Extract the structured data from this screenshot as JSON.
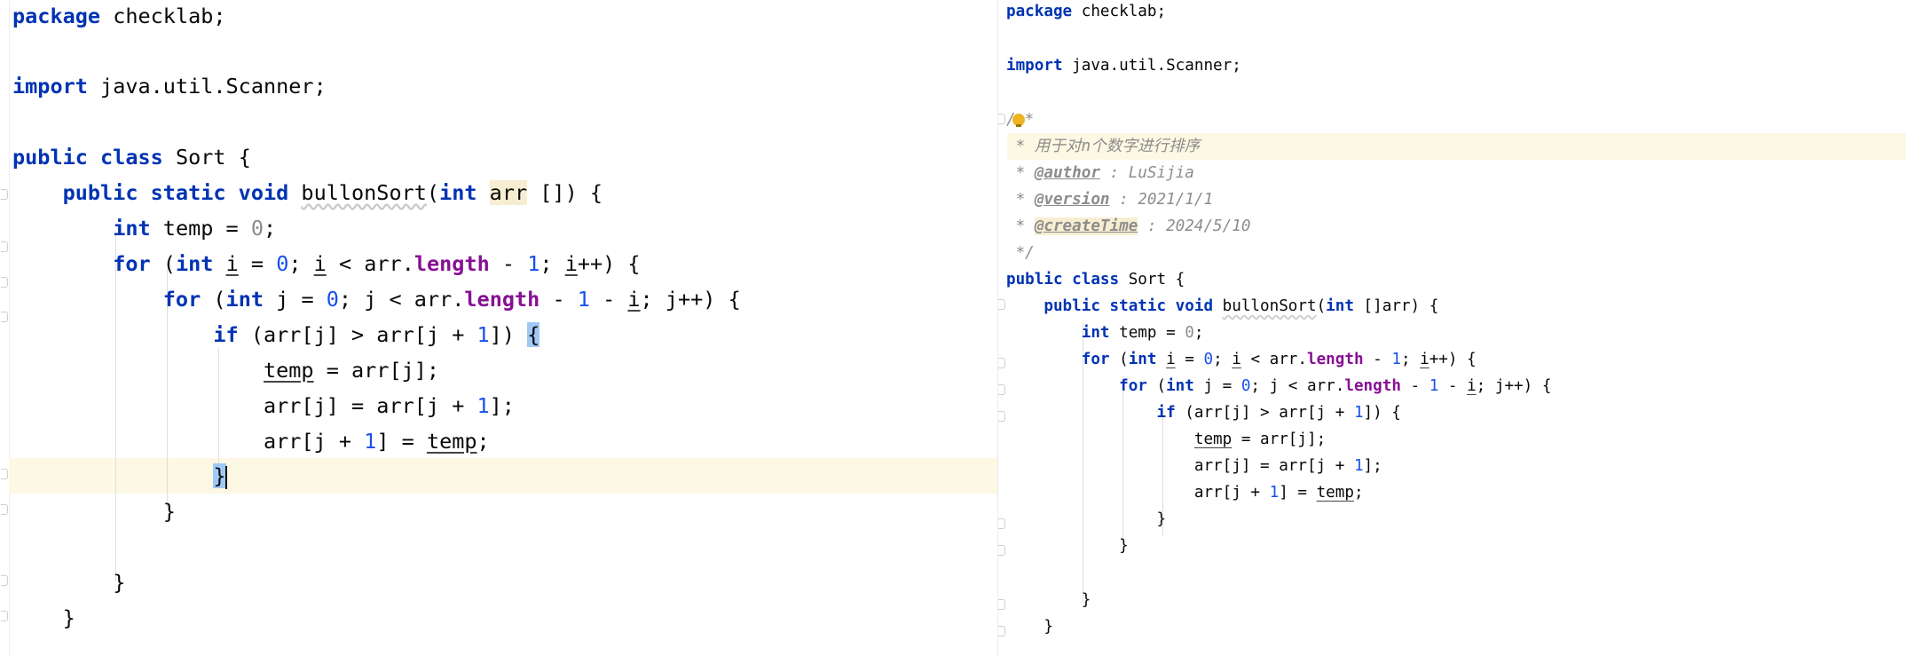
{
  "left": {
    "line1": {
      "kw": "package",
      "rest": "checklab;"
    },
    "line2": {
      "kw": "import",
      "rest": "java.util.Scanner;"
    },
    "line3": {
      "kw": "public class",
      "name": "Sort",
      "rest": "{"
    },
    "line4": {
      "kw": "public static void",
      "method": "bullonSort",
      "open": "(",
      "kw2": "int",
      "param": "arr",
      "rest": "[]) {"
    },
    "line5": {
      "kw": "int",
      "var": "temp",
      "eq": "=",
      "val": "0",
      "semi": ";"
    },
    "line6": {
      "kw": "for",
      "p1": "(",
      "kw2": "int",
      "v1": "i",
      "p2": "=",
      "n1": "0",
      "p3": ";",
      "v2": "i",
      "p4": "< arr.",
      "field": "length",
      "p5": "-",
      "n2": "1",
      "p6": ";",
      "v3": "i",
      "p7": "++) {"
    },
    "line7": {
      "kw": "for",
      "p1": "(",
      "kw2": "int",
      "p2": "j =",
      "n1": "0",
      "p3": "; j < arr.",
      "field": "length",
      "p4": "-",
      "n2": "1",
      "p5": "-",
      "v1": "i",
      "p6": "; j++) {"
    },
    "line8": {
      "kw": "if",
      "p1": "(arr[j] > arr[j +",
      "n1": "1",
      "p2": "])",
      "brace": "{"
    },
    "line9": {
      "var": "temp",
      "rest": "= arr[j];"
    },
    "line10": {
      "p1": "arr[j] = arr[j +",
      "n1": "1",
      "p2": "];"
    },
    "line11": {
      "p1": "arr[j +",
      "n1": "1",
      "p2": "] =",
      "var": "temp",
      "p3": ";"
    },
    "line12": {
      "brace": "}"
    },
    "line13": {
      "text": "}"
    },
    "line14": {
      "text": "}"
    },
    "line15": {
      "text": "}"
    }
  },
  "right": {
    "line1": {
      "kw": "package",
      "rest": "checklab;"
    },
    "line2": {
      "kw": "import",
      "rest": "java.util.Scanner;"
    },
    "line3": {
      "slash": "/",
      "star": "*"
    },
    "line4": {
      "text": " * 用于对n个数字进行排序"
    },
    "line5": {
      "star": " *",
      "tag": "@author",
      "rest": ": LuSijia"
    },
    "line6": {
      "star": " *",
      "tag": "@version",
      "rest": ": 2021/1/1"
    },
    "line7": {
      "star": " *",
      "tag": "@createTime",
      "rest": ": 2024/5/10"
    },
    "line8": {
      "text": " */"
    },
    "line9": {
      "kw": "public class",
      "rest": "Sort {"
    },
    "line10": {
      "kw": "public static void",
      "method": "bullonSort",
      "open": "(",
      "kw2": "int",
      "rest": "[]arr) {"
    },
    "line11": {
      "kw": "int",
      "var": "temp",
      "eq": "=",
      "val": "0",
      "semi": ";"
    },
    "line12": {
      "kw": "for",
      "p1": "(",
      "kw2": "int",
      "v1": "i",
      "p2": "=",
      "n1": "0",
      "p3": ";",
      "v2": "i",
      "p4": "< arr.",
      "field": "length",
      "p5": "-",
      "n2": "1",
      "p6": ";",
      "v3": "i",
      "p7": "++) {"
    },
    "line13": {
      "kw": "for",
      "p1": "(",
      "kw2": "int",
      "p2": "j =",
      "n1": "0",
      "p3": "; j < arr.",
      "field": "length",
      "p4": "-",
      "n2": "1",
      "p5": "-",
      "v1": "i",
      "p6": "; j++) {"
    },
    "line14": {
      "kw": "if",
      "p1": "(arr[j] > arr[j +",
      "n1": "1",
      "p2": "]) {"
    },
    "line15": {
      "var": "temp",
      "rest": "= arr[j];"
    },
    "line16": {
      "p1": "arr[j] = arr[j +",
      "n1": "1",
      "p2": "];"
    },
    "line17": {
      "p1": "arr[j +",
      "n1": "1",
      "p2": "] =",
      "var": "temp",
      "p3": ";"
    },
    "line18": {
      "text": "}"
    },
    "line19": {
      "text": "}"
    },
    "line20": {
      "text": "}"
    },
    "line21": {
      "text": "}"
    }
  },
  "icons": {
    "intention": "lightbulb-icon"
  },
  "colors": {
    "keyword": "#0033b3",
    "number": "#1750eb",
    "field": "#871094",
    "comment": "#8c8c8c",
    "caret_line": "#fcf8e3",
    "brace_match": "#9fc8f5"
  }
}
